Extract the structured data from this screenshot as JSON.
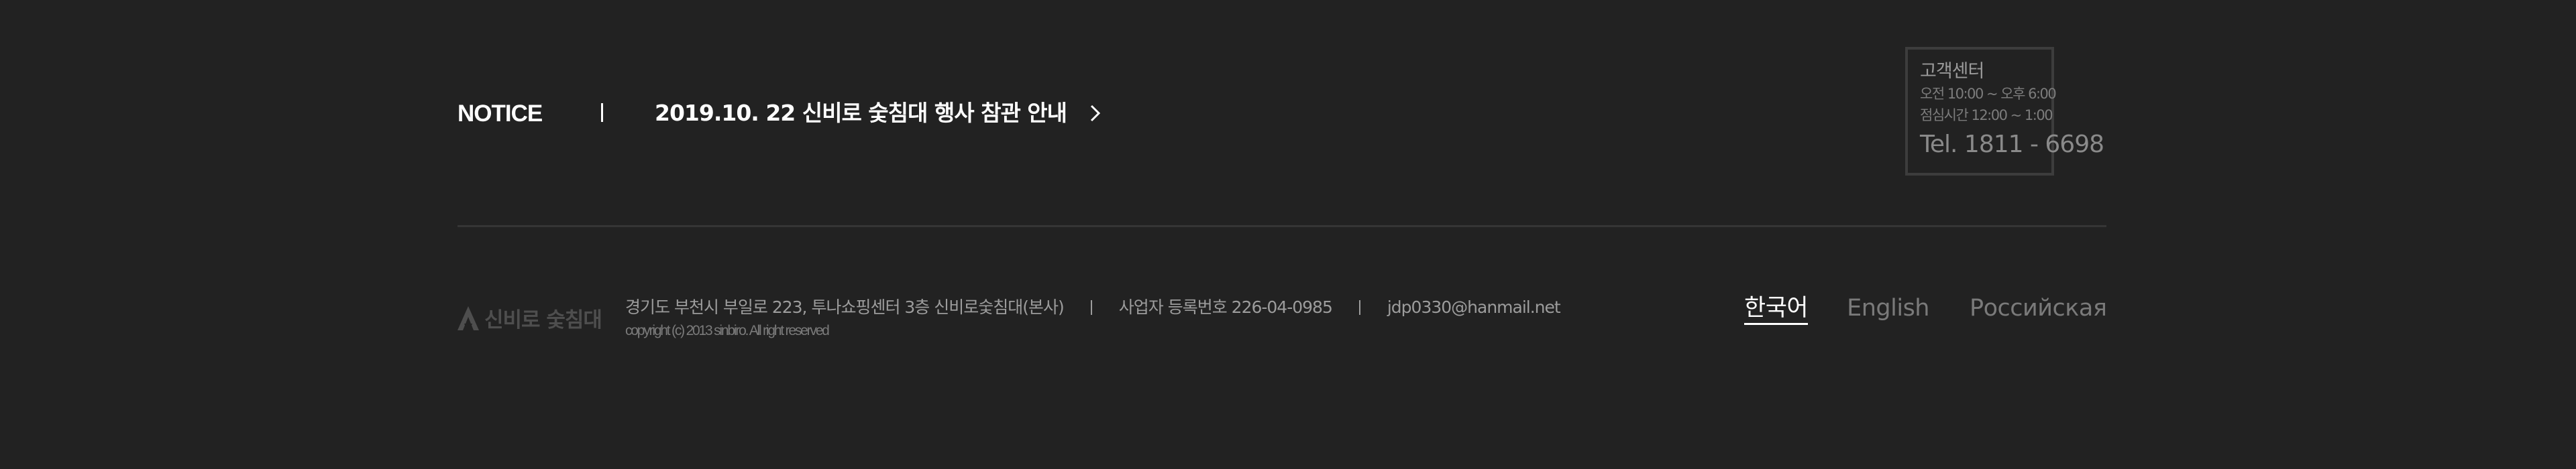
{
  "notice": {
    "label": "NOTICE",
    "headline": "2019.10. 22 신비로 숯침대 행사 참관 안내"
  },
  "customer_center": {
    "title": "고객센터",
    "hours": "오전 10:00 ~ 오후 6:00",
    "lunch": "점심시간 12:00 ~ 1:00",
    "tel": "Tel. 1811 - 6698"
  },
  "footer": {
    "logo_text": "신비로 숯침대",
    "address": "경기도 부천시 부일로 223, 투나쇼핑센터 3층 신비로숯침대(본사)",
    "business_number": "사업자 등록번호 226-04-0985",
    "email": "jdp0330@hanmail.net",
    "copyright": "copyright (c) 2013 sinbiro. All right reserved"
  },
  "languages": [
    {
      "label": "한국어",
      "active": true
    },
    {
      "label": "English",
      "active": false
    },
    {
      "label": "Российская",
      "active": false
    }
  ],
  "colors": {
    "background": "#222222",
    "divider": "#353535",
    "text_primary": "#ffffff",
    "text_muted": "#9c9c9c"
  },
  "icons": {
    "notice_arrow": "chevron-right-icon",
    "logo": "logo-mark-icon"
  }
}
